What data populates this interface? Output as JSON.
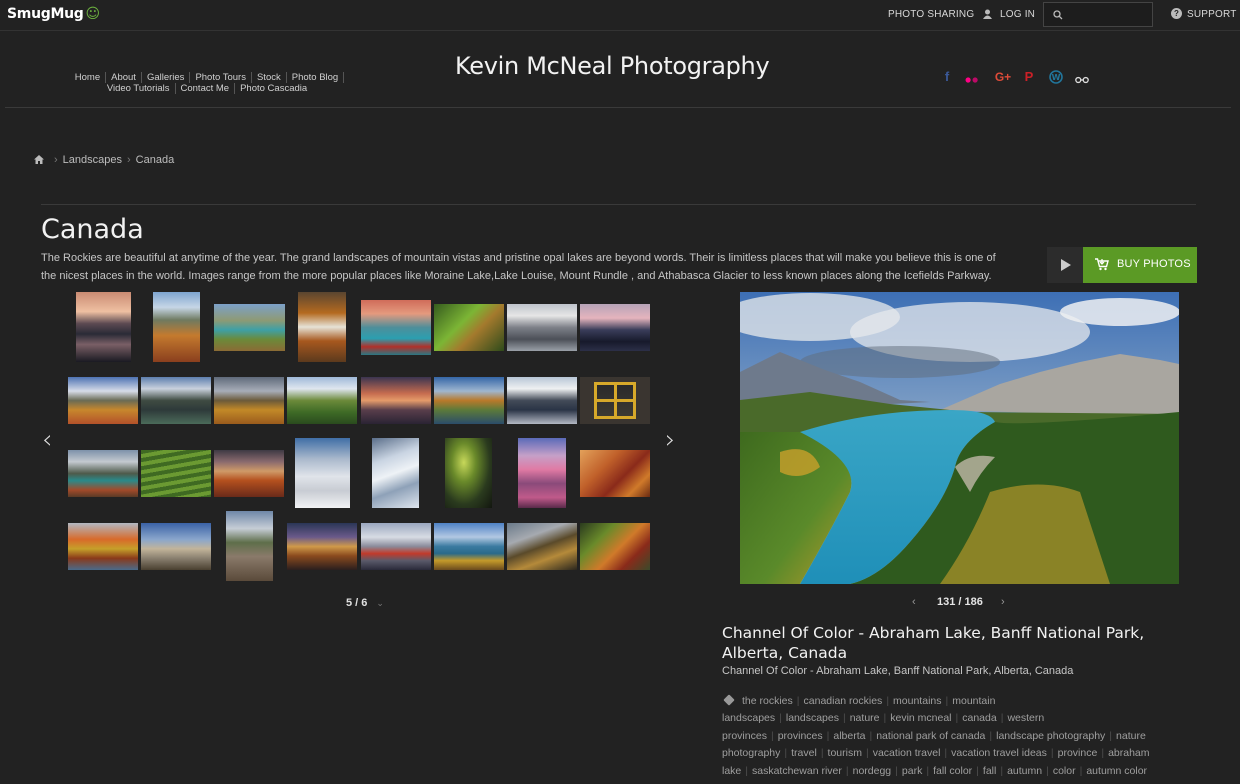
{
  "topbar": {
    "logo": "SmugMug",
    "photo_sharing": "PHOTO SHARING",
    "login": "LOG IN",
    "support": "SUPPORT"
  },
  "site": {
    "title": "Kevin McNeal Photography",
    "nav": [
      "Home",
      "About",
      "Galleries",
      "Photo Tours",
      "Stock",
      "Photo Blog",
      "Video Tutorials",
      "Contact Me",
      "Photo Cascadia"
    ],
    "social": [
      "facebook-icon",
      "flickr-icon",
      "google-plus-icon",
      "pinterest-icon",
      "wordpress-icon",
      "smugmug-icon"
    ]
  },
  "breadcrumb": {
    "items": [
      "Landscapes",
      "Canada"
    ]
  },
  "gallery": {
    "title": "Canada",
    "description": "The Rockies are beautiful at anytime of the year. The grand landscapes of mountain vistas and pristine opal lakes are beyond words. Their is limitless places that will make you believe this is one of the nicest places in the world. Images range from the more popular places like Moraine Lake,Lake Louise, Mount Rundle , and Athabasca Glacier to less known places along the Icefields Parkway.",
    "buy_label": "BUY PHOTOS",
    "page_indicator": "5 / 6",
    "thumbnail_count": 32
  },
  "photo": {
    "counter": "131 / 186",
    "title": "Channel Of Color - Abraham Lake, Banff National Park, Alberta, Canada",
    "caption": "Channel Of Color - Abraham Lake, Banff National Park, Alberta, Canada",
    "tags": [
      "the rockies",
      "canadian rockies",
      "mountains",
      "mountain landscapes",
      "landscapes",
      "nature",
      "kevin mcneal",
      "canada",
      "western provinces",
      "provinces",
      "alberta",
      "national park of canada",
      "landscape photography",
      "nature photography",
      "travel",
      "tourism",
      "vacation travel",
      "vacation travel ideas",
      "province",
      "abraham lake",
      "saskatchewan river",
      "nordegg",
      "park",
      "fall color",
      "fall",
      "autumn",
      "color",
      "autumn color"
    ]
  },
  "colors": {
    "background": "#222222",
    "accent_buy": "#5b9a25",
    "logo_smile": "#6db33f"
  }
}
